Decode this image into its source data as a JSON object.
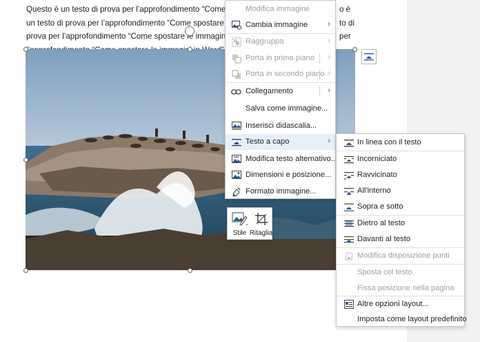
{
  "document": {
    "lines": [
      "Questo è un testo di prova per l’approfondimento “Come spo",
      "un testo di prova per l’approfondimento “Come spostare le i",
      "prova per l’approfondimento “Come spostare le immagini in",
      "l’approfondimento “Come spostare le immagini in Word”."
    ],
    "right_fragments": [
      "o è",
      "to di",
      "per"
    ]
  },
  "context_menu": {
    "items": [
      {
        "label": "Modifica immagine",
        "icon": "edit-image-icon",
        "disabled": true,
        "submenu": false
      },
      {
        "label": "Cambia immagine",
        "icon": "change-picture-icon",
        "disabled": false,
        "submenu": true
      },
      {
        "label": "Raggruppa",
        "icon": "group-icon",
        "disabled": true,
        "submenu": true
      },
      {
        "label": "Porta in primo piano",
        "icon": "bring-forward-icon",
        "disabled": true,
        "submenu": true
      },
      {
        "label": "Porta in secondo piano",
        "icon": "send-backward-icon",
        "disabled": true,
        "submenu": true
      },
      {
        "label": "Collegamento",
        "icon": "link-icon",
        "disabled": false,
        "submenu": true
      },
      {
        "label": "Salva come immagine...",
        "icon": "",
        "disabled": false,
        "submenu": false
      },
      {
        "label": "Inserisci didascalia...",
        "icon": "caption-icon",
        "disabled": false,
        "submenu": false
      },
      {
        "label": "Testo a capo",
        "icon": "wrap-text-icon",
        "disabled": false,
        "submenu": true,
        "highlighted": true
      },
      {
        "label": "Modifica testo alternativo...",
        "icon": "alt-text-icon",
        "disabled": false,
        "submenu": false
      },
      {
        "label": "Dimensioni e posizione...",
        "icon": "size-position-icon",
        "disabled": false,
        "submenu": false
      },
      {
        "label": "Formato immagine...",
        "icon": "format-picture-icon",
        "disabled": false,
        "submenu": false
      }
    ]
  },
  "wrap_submenu": {
    "items": [
      {
        "label": "In linea con il testo",
        "icon": "inline-wrap-icon",
        "disabled": false
      },
      {
        "label": "Incorniciato",
        "icon": "square-wrap-icon",
        "disabled": false
      },
      {
        "label": "Ravvicinato",
        "icon": "tight-wrap-icon",
        "disabled": false
      },
      {
        "label": "All'interno",
        "icon": "through-wrap-icon",
        "disabled": false
      },
      {
        "label": "Sopra e sotto",
        "icon": "top-bottom-wrap-icon",
        "disabled": false
      },
      {
        "label": "Dietro al testo",
        "icon": "behind-text-icon",
        "disabled": false
      },
      {
        "label": "Davanti al testo",
        "icon": "front-text-icon",
        "disabled": false
      },
      {
        "label": "Modifica disposizione punti",
        "icon": "edit-wrap-points-icon",
        "disabled": true
      },
      {
        "label": "Sposta col testo",
        "icon": "",
        "disabled": true
      },
      {
        "label": "Fissa posizione nella pagina",
        "icon": "",
        "disabled": true
      },
      {
        "label": "Altre opzioni layout...",
        "icon": "more-layout-icon",
        "disabled": false
      },
      {
        "label": "Imposta come layout predefinito",
        "icon": "",
        "disabled": false
      }
    ]
  },
  "mini_toolbar": {
    "style_label": "Stile",
    "crop_label": "Ritaglia"
  },
  "colors": {
    "accent": "#2b579a",
    "highlight": "#e5f0fb",
    "disabled": "#a0a0a0"
  }
}
